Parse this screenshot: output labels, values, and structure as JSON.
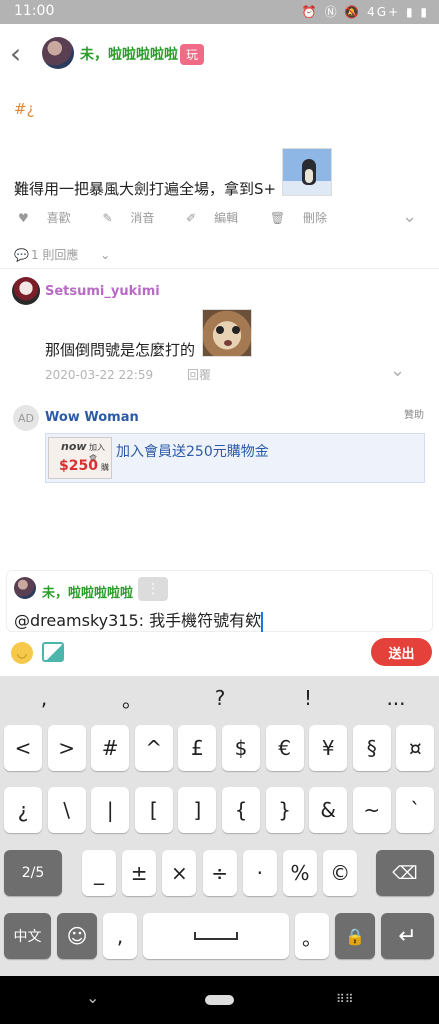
{
  "status": {
    "time": "11:00",
    "icons": "⏰ Ⓝ 🔕 4G+ ▮ ▮"
  },
  "post": {
    "author": "未，啦啦啦啦啦",
    "badge": "玩",
    "hashtag": "#¿",
    "body": "難得用一把暴風大劍打遍全場，拿到S+",
    "actions": {
      "like": "喜歡",
      "mute": "消音",
      "edit": "編輯",
      "delete": "刪除"
    },
    "reply_count": "1 則回應"
  },
  "comment": {
    "author": "Setsumi_yukimi",
    "text": "那個倒問號是怎麼打的",
    "time": "2020-03-22 22:59",
    "reply": "回覆"
  },
  "ad": {
    "avatar": "AD",
    "name": "Wow Woman",
    "sponsor": "贊助",
    "thumb_line1": "now",
    "thumb_line2": "加入會",
    "thumb_price": "$250",
    "thumb_unit": "購",
    "text": "加入會員送250元購物金"
  },
  "composer": {
    "author": "未，啦啦啦啦啦",
    "more": "⋮",
    "text": "@dreamsky315: 我手機符號有欸",
    "send": "送出"
  },
  "keyboard": {
    "suggest": [
      ",",
      "。",
      "?",
      "!",
      "..."
    ],
    "row1": [
      "<",
      ">",
      "#",
      "^",
      "£",
      "$",
      "€",
      "¥",
      "§",
      "¤"
    ],
    "row2": [
      "¿",
      "\\",
      "|",
      "[",
      "]",
      "{",
      "}",
      "&",
      "~",
      "`"
    ],
    "row3": [
      "_",
      "±",
      "×",
      "÷",
      "·",
      "%",
      "©"
    ],
    "page": "2/5",
    "lang": "中文",
    "comma": ",",
    "period": "。"
  }
}
